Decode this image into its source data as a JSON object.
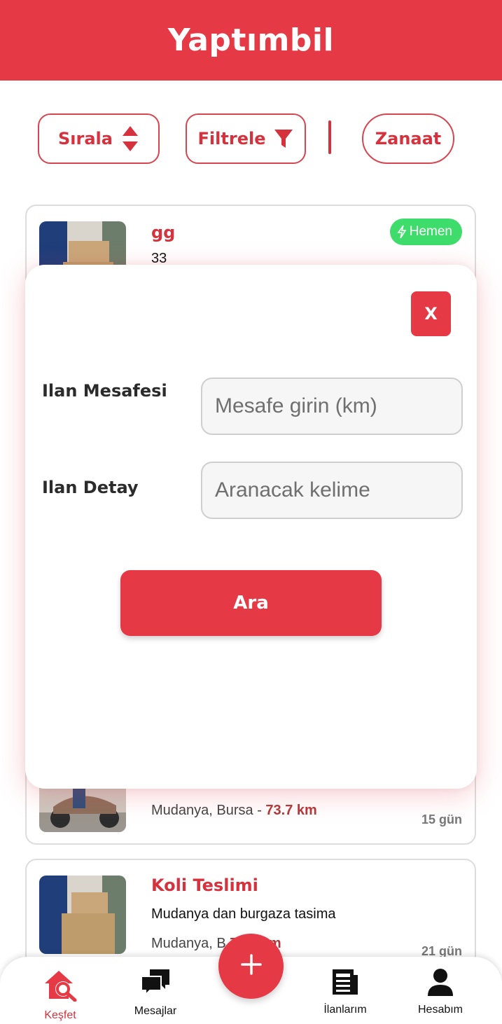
{
  "app": {
    "title": "Yaptımbil"
  },
  "toolbar": {
    "sort_label": "Sırala",
    "filter_label": "Filtrele",
    "craft_label": "Zanaat"
  },
  "listings": [
    {
      "title": "gg",
      "desc": "33",
      "badge": "Hemen"
    },
    {
      "location": "Mudanya, Bursa - ",
      "distance": "73.7 km",
      "age": "15 gün"
    },
    {
      "title": "Koli Teslimi",
      "desc": "Mudanya dan burgaza tasima",
      "location": "Mudanya, B",
      "distance": "74.2 km",
      "age": "21 gün"
    }
  ],
  "modal": {
    "close_label": "X",
    "distance_label": "Ilan Mesafesi",
    "distance_placeholder": "Mesafe girin (km)",
    "detail_label": "Ilan Detay",
    "detail_placeholder": "Aranacak kelime",
    "search_label": "Ara"
  },
  "nav": {
    "items": [
      {
        "label": "Keşfet",
        "icon": "home-search-icon",
        "active": true
      },
      {
        "label": "Mesajlar",
        "icon": "chat-bubbles-icon"
      },
      {
        "label": "İlanlarım",
        "icon": "newspaper-icon"
      },
      {
        "label": "Hesabım",
        "icon": "user-icon"
      }
    ]
  },
  "colors": {
    "brand": "#e63946",
    "badge": "#3ddc6b"
  }
}
